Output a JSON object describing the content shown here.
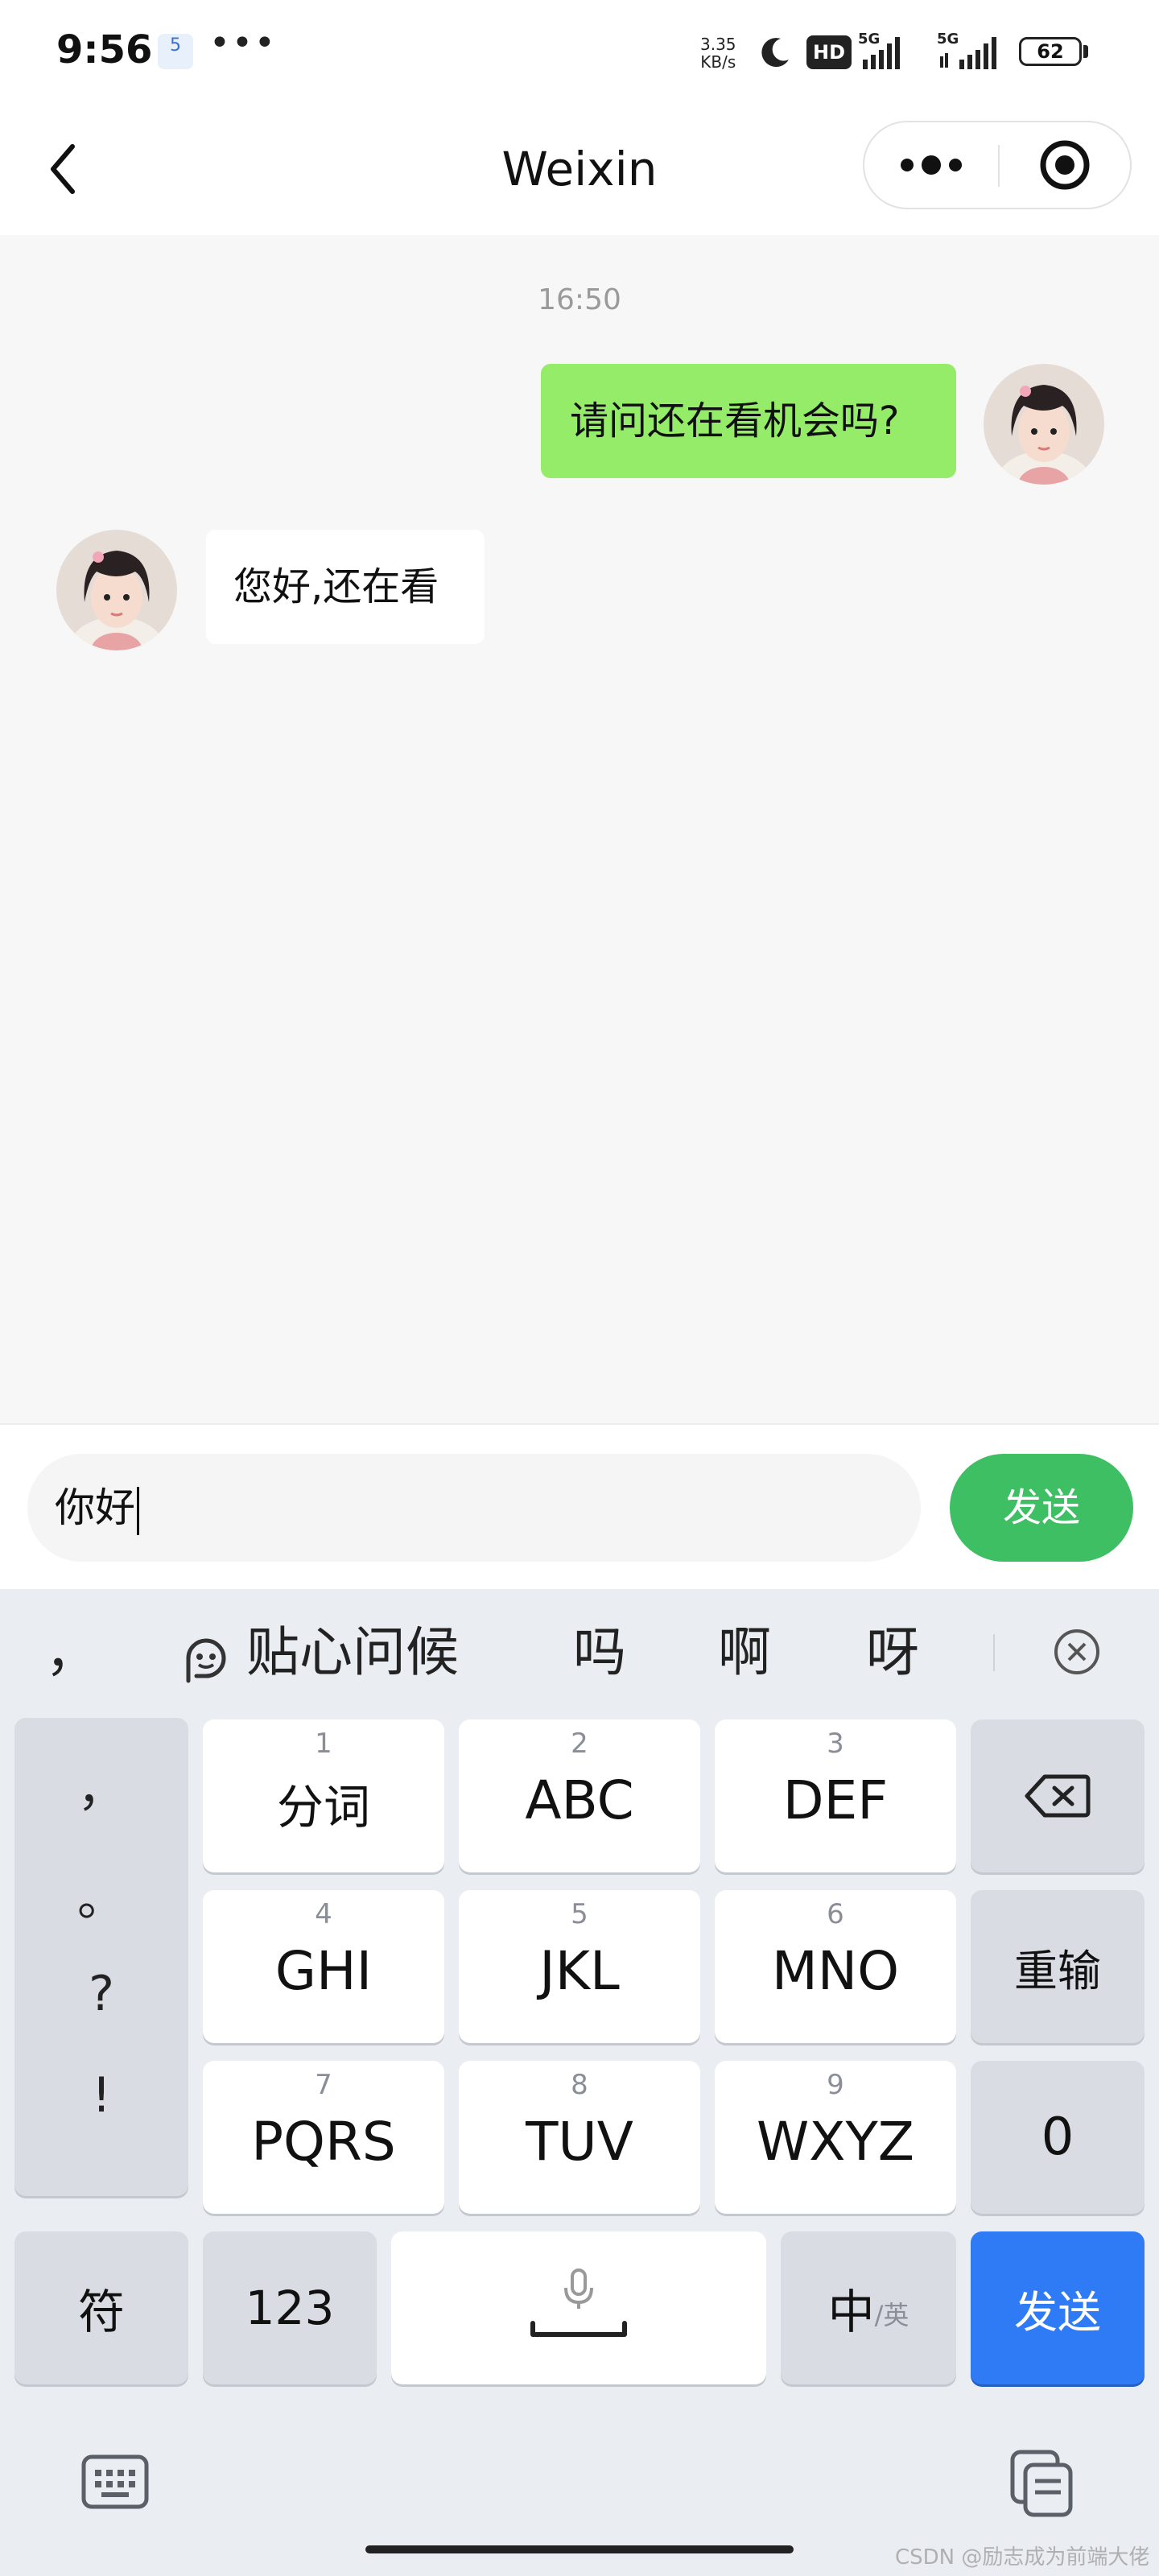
{
  "status_bar": {
    "time": "9:56",
    "app_badge": "5",
    "dots": "•••",
    "net_speed_value": "3.35",
    "net_speed_unit": "KB/s",
    "hd_label": "HD",
    "sim1_label": "5G",
    "sim2_label": "5G",
    "battery": "62"
  },
  "header": {
    "title": "Weixin",
    "back_icon": "chevron-left-icon",
    "more_icon": "more-dots-icon",
    "target_icon": "target-circle-icon"
  },
  "chat": {
    "timestamp": "16:50",
    "messages": [
      {
        "direction": "outgoing",
        "text": "请问还在看机会吗?"
      },
      {
        "direction": "incoming",
        "text": "您好,还在看"
      }
    ]
  },
  "input_bar": {
    "value": "你好",
    "send_label": "发送",
    "send_color": "#3fbf63"
  },
  "keyboard": {
    "suggestions": {
      "comma": "，",
      "feature_label": "贴心问候",
      "words": [
        "吗",
        "啊",
        "呀"
      ]
    },
    "punctuation": [
      "，",
      "。",
      "?",
      "!"
    ],
    "keys": [
      {
        "num": "1",
        "label": "分词"
      },
      {
        "num": "2",
        "label": "ABC"
      },
      {
        "num": "3",
        "label": "DEF"
      },
      {
        "num": "4",
        "label": "GHI"
      },
      {
        "num": "5",
        "label": "JKL"
      },
      {
        "num": "6",
        "label": "MNO"
      },
      {
        "num": "7",
        "label": "PQRS"
      },
      {
        "num": "8",
        "label": "TUV"
      },
      {
        "num": "9",
        "label": "WXYZ"
      }
    ],
    "reinput_label": "重输",
    "zero_label": "0",
    "symbol_label": "符",
    "num_label": "123",
    "lang_main": "中",
    "lang_alt": "/英",
    "send_label": "发送",
    "send_color": "#2f7bf6"
  },
  "watermark": "CSDN @励志成为前端大佬"
}
